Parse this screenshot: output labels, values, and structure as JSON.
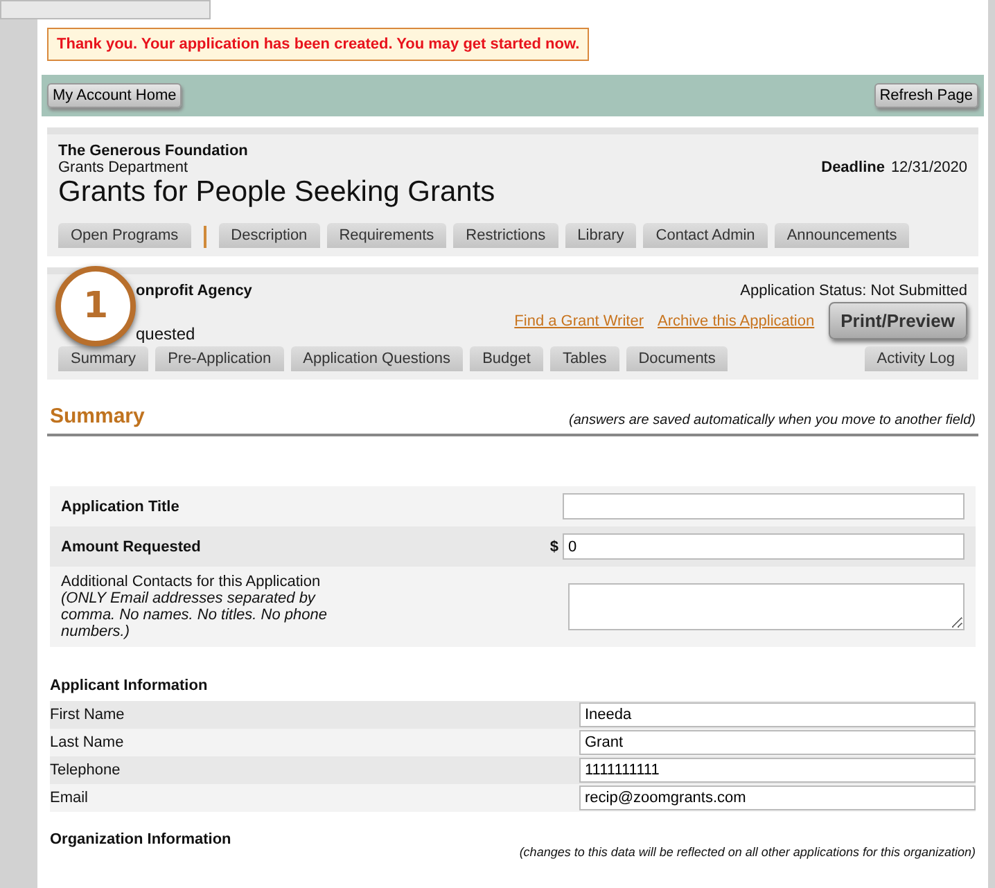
{
  "message": "Thank you. Your application has been created. You may get started now.",
  "top_bar": {
    "left_button": "My Account Home",
    "right_button": "Refresh Page"
  },
  "program": {
    "organization": "The Generous Foundation",
    "department": "Grants Department",
    "title": "Grants for People Seeking Grants",
    "deadline_label": "Deadline",
    "deadline": "12/31/2020",
    "tabs": [
      {
        "label": "Open Programs"
      },
      {
        "label": "Description"
      },
      {
        "label": "Requirements"
      },
      {
        "label": "Restrictions"
      },
      {
        "label": "Library"
      },
      {
        "label": "Contact Admin"
      },
      {
        "label": "Announcements"
      }
    ]
  },
  "application": {
    "badge": "1",
    "agency": "onprofit Agency",
    "amount": "quested",
    "status": "Application Status: Not Submitted",
    "links": [
      "Find a Grant Writer",
      "Archive this Application"
    ],
    "print_button": "Print/Preview",
    "tabs": [
      {
        "label": "Summary"
      },
      {
        "label": "Pre-Application"
      },
      {
        "label": "Application Questions"
      },
      {
        "label": "Budget"
      },
      {
        "label": "Tables"
      },
      {
        "label": "Documents"
      }
    ],
    "log_tab": "Activity Log"
  },
  "summary": {
    "heading": "Summary",
    "note": "(answers are saved automatically when you move to another field)",
    "fields": [
      {
        "kind": "text",
        "label": "Application Title"
      },
      {
        "kind": "money",
        "label": "Amount Requested",
        "prefix": "$",
        "value": "0"
      },
      {
        "kind": "area",
        "label": "Additional Contacts for this Application",
        "hint": "(ONLY Email addresses separated by comma. No names. No titles. No phone numbers.)"
      }
    ]
  },
  "applicant": {
    "heading": "Applicant Information",
    "fields": [
      {
        "label": "First Name",
        "value": "Ineeda"
      },
      {
        "label": "Last Name",
        "value": "Grant"
      },
      {
        "label": "Telephone",
        "value": "1111111111"
      },
      {
        "label": "Email",
        "value": "recip@zoomgrants.com"
      }
    ]
  },
  "organization": {
    "heading": "Organization Information",
    "note": "(changes to this data will be reflected on all other applications for this organization)"
  }
}
